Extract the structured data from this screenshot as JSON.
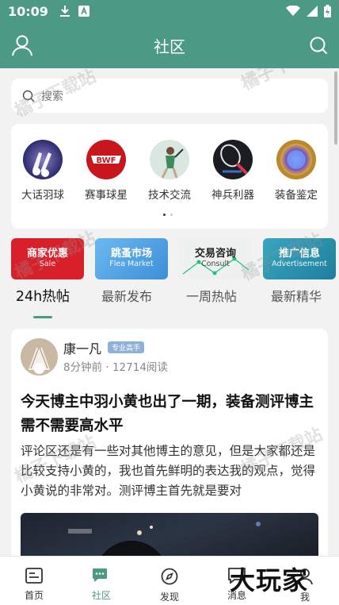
{
  "status_bar": {
    "time": "10:09",
    "icons": [
      "download-icon",
      "a-icon",
      "wifi-icon",
      "signal-icon",
      "battery-icon"
    ]
  },
  "header": {
    "title": "社区",
    "left_icon": "user-icon",
    "right_icon": "search-icon"
  },
  "search": {
    "placeholder": "搜索"
  },
  "categories": [
    {
      "label": "大话羽球"
    },
    {
      "label": "赛事球星"
    },
    {
      "label": "技术交流"
    },
    {
      "label": "神兵利器"
    },
    {
      "label": "装备鉴定"
    }
  ],
  "pager": {
    "count": 2,
    "active": 0
  },
  "banners": [
    {
      "title": "商家优惠",
      "subtitle": "Sale",
      "color": "#d8202a"
    },
    {
      "title": "跳蚤市场",
      "subtitle": "Flea Market",
      "color": "#5aa8e8"
    },
    {
      "title": "交易咨询",
      "subtitle": "Consult",
      "color": "#e8ecec"
    },
    {
      "title": "推广信息",
      "subtitle": "Advertisement",
      "color": "#2d95b0"
    }
  ],
  "tabs": [
    {
      "label": "24h热帖",
      "active": true
    },
    {
      "label": "最新发布",
      "active": false
    },
    {
      "label": "一周热帖",
      "active": false
    },
    {
      "label": "最新精华",
      "active": false
    }
  ],
  "post": {
    "author": "康一凡",
    "badge": "专业高手",
    "meta": "8分钟前 · 12714阅读",
    "title": "今天博主中羽小黄也出了一期，装备测评博主需不需要高水平",
    "body": "评论区还是有一些对其他博主的意见，但是大家都还是比较支持小黄的，我也首先鲜明的表达我的观点，觉得小黄说的非常对。测评博主首先就是要对"
  },
  "bottom_nav": [
    {
      "label": "首页",
      "icon": "home-icon",
      "active": false
    },
    {
      "label": "社区",
      "icon": "community-icon",
      "active": true
    },
    {
      "label": "发现",
      "icon": "compass-icon",
      "active": false
    },
    {
      "label": "消息",
      "icon": "message-icon",
      "active": false
    },
    {
      "label": "我",
      "icon": "profile-icon",
      "active": false
    }
  ],
  "watermark": "橘子下载站",
  "corner_logo": "大玩家",
  "colors": {
    "brand": "#4c9a85",
    "background": "#f2f2f2"
  }
}
